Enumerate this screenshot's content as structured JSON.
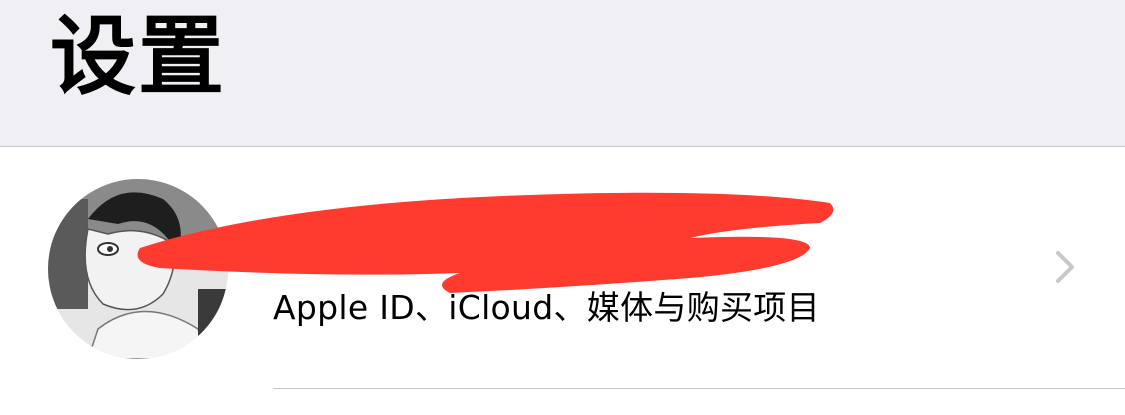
{
  "header": {
    "title": "设置"
  },
  "account": {
    "avatar_icon": "profile-avatar",
    "subtitle": "Apple ID、iCloud、媒体与购买项目",
    "chevron_icon": "chevron-right-icon",
    "redaction_color": "#ff3b30"
  },
  "colors": {
    "header_bg": "#efeff4",
    "separator": "#c8c7cc",
    "chevron": "#c7c7cc"
  }
}
